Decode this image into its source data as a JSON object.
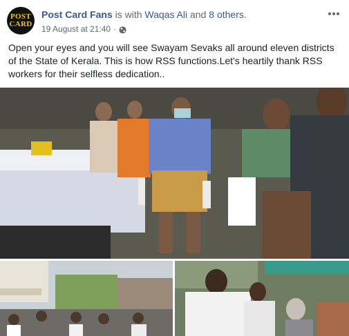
{
  "post": {
    "page_name": "Post Card Fans",
    "with_text": " is with ",
    "tagged_person": "Waqas Ali",
    "and_text": " and ",
    "others": "8 others",
    "period": ".",
    "timestamp": "19 August at 21:40",
    "separator": "·",
    "privacy_icon": "globe-icon",
    "avatar_text_1": "POST",
    "avatar_text_2": "CARD",
    "text": "Open your eyes and you will see Swayam Sevaks all around eleven districts of the State of Kerala. This is how RSS functions.Let's heartily thank RSS workers for their selfless dedication..",
    "more_icon": "ellipsis-icon",
    "photos": [
      "main-photo",
      "bottom-left-photo",
      "bottom-right-photo"
    ],
    "colors": {
      "link": "#385898",
      "meta": "#606770",
      "text": "#1c1e21"
    }
  }
}
